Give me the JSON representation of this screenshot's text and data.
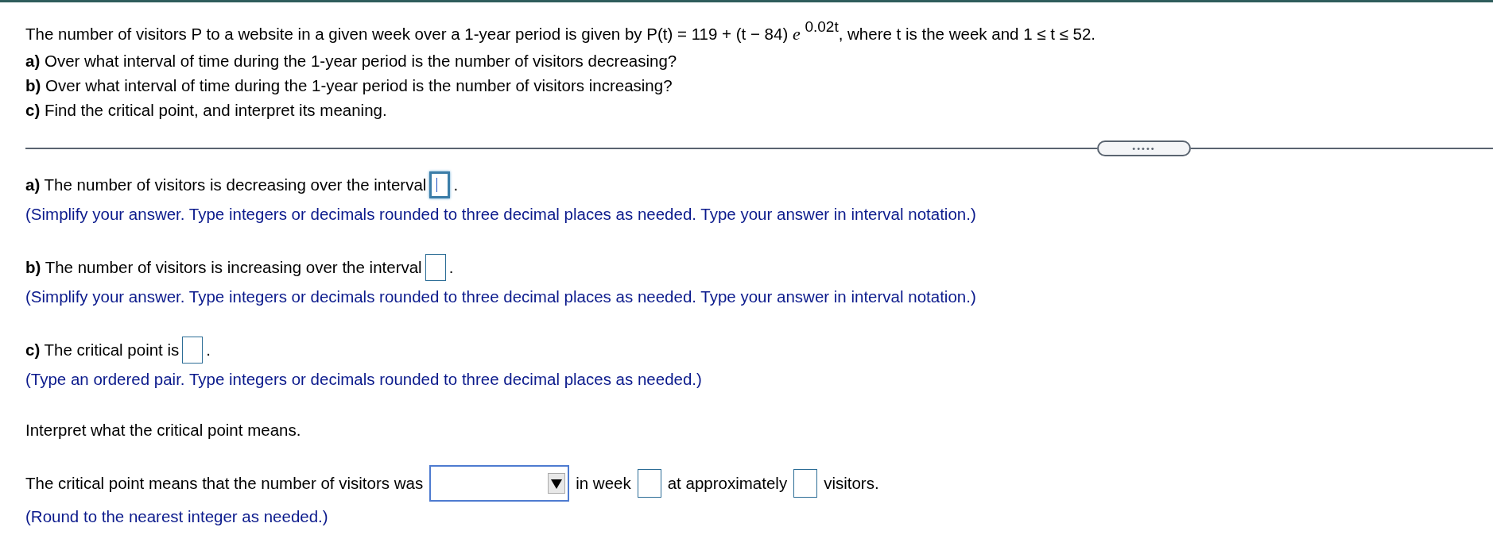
{
  "question": {
    "intro": "The number of visitors P to a website in a given week over a 1-year period is given by P(t) = 119 + (t − 84) *e* $^{0.02t}$, where t is the week and 1 ≤ t ≤ 52.",
    "parts": [
      {
        "label": "a)",
        "text": "Over what interval of time during the 1-year period is the number of visitors decreasing?"
      },
      {
        "label": "b)",
        "text": "Over what interval of time during the 1-year period is the number of visitors increasing?"
      },
      {
        "label": "c)",
        "text": "Find the critical point, and interpret its meaning."
      }
    ]
  },
  "expand_button": "•••••",
  "answers": [
    {
      "label": "a)",
      "text": "The number of visitors is decreasing over the interval",
      "focused": true,
      "end": ".",
      "hint": "(Simplify your answer. Type integers or decimals rounded to three decimal places as needed. Type your answer in interval notation.)"
    },
    {
      "label": "b)",
      "text": "The number of visitors is increasing over the interval",
      "focused": false,
      "end": ".",
      "hint": "(Simplify your answer. Type integers or decimals rounded to three decimal places as needed. Type your answer in interval notation.)"
    },
    {
      "label": "c)",
      "text": "The critical point is",
      "focused": false,
      "end": ".",
      "hint": "(Type an ordered pair. Type integers or decimals rounded to three decimal places as needed.)"
    }
  ],
  "interpret": {
    "prompt": "Interpret what the critical point means.",
    "sentence": [
      {
        "kind": "text",
        "text": "The critical point means that the number of visitors was"
      },
      {
        "kind": "dropdown"
      },
      {
        "kind": "text",
        "text": "in week"
      },
      {
        "kind": "box"
      },
      {
        "kind": "text",
        "text": "at approximately"
      },
      {
        "kind": "box"
      },
      {
        "kind": "text",
        "text": "visitors."
      }
    ],
    "hint": "(Round to the nearest integer as needed.)"
  }
}
